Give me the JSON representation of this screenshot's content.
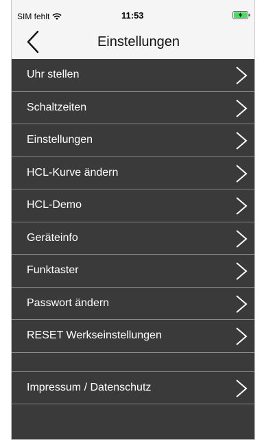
{
  "status": {
    "carrier": "SIM fehlt",
    "time": "11:53",
    "wifi_icon": "wifi-icon",
    "battery_icon": "battery-charging-icon"
  },
  "nav": {
    "title": "Einstellungen",
    "back_icon": "chevron-left-icon"
  },
  "menu": {
    "items": [
      {
        "label": "Uhr stellen"
      },
      {
        "label": "Schaltzeiten"
      },
      {
        "label": "Einstellungen"
      },
      {
        "label": "HCL-Kurve ändern"
      },
      {
        "label": "HCL-Demo"
      },
      {
        "label": "Geräteinfo"
      },
      {
        "label": "Funktaster"
      },
      {
        "label": "Passwort ändern"
      },
      {
        "label": "RESET Werkseinstellungen"
      }
    ],
    "footer_item": {
      "label": "Impressum / Datenschutz"
    },
    "chevron_icon": "chevron-right-icon"
  },
  "colors": {
    "list_background": "#3a3a3a",
    "divider": "#8a8a8a",
    "battery_fill": "#4cd964"
  }
}
